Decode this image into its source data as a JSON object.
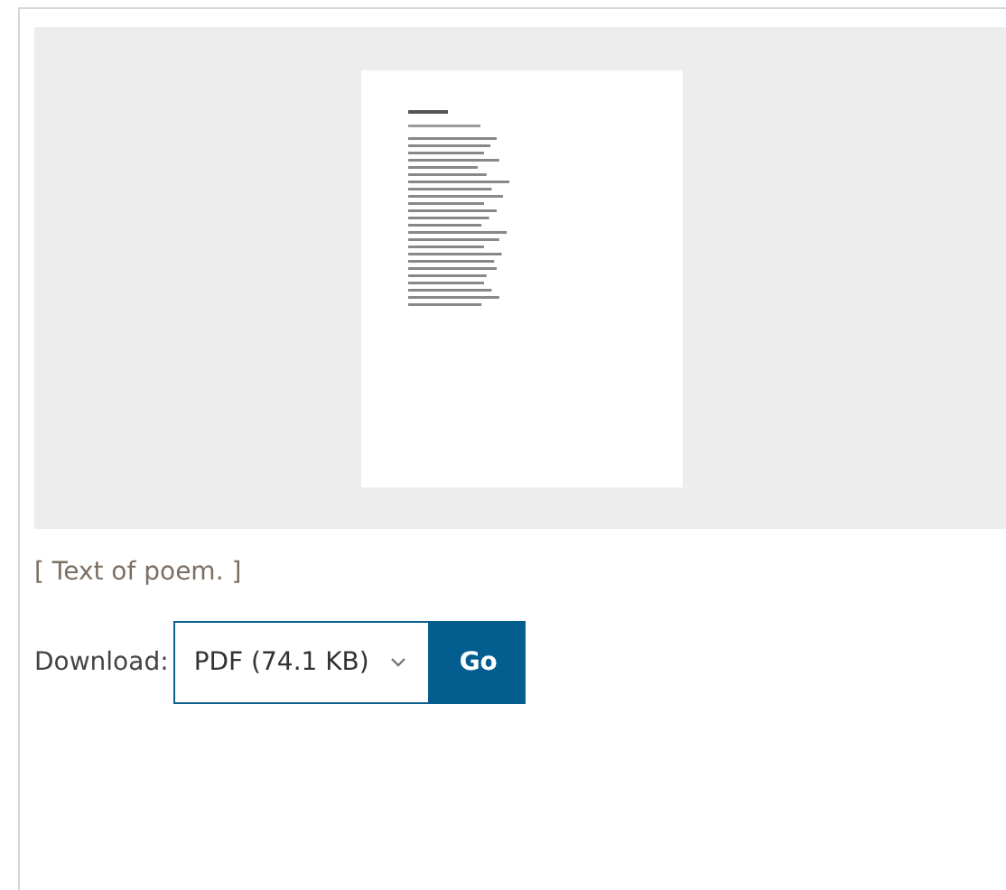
{
  "preview": {
    "kind": "document-thumbnail"
  },
  "caption": "[ Text of poem. ]",
  "download": {
    "label": "Download:",
    "format": "PDF (74.1 KB)",
    "button": "Go"
  }
}
